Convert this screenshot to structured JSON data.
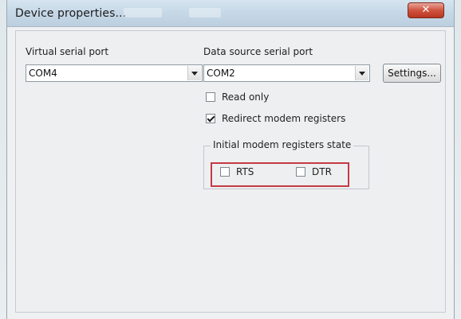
{
  "window": {
    "title": "Device properties...",
    "close_label": "✕"
  },
  "left_panel": {
    "virtual_serial_port_label": "Virtual serial port",
    "virtual_serial_port_value": "COM4"
  },
  "right_panel": {
    "data_source_label": "Data source serial port",
    "data_source_value": "COM2",
    "settings_button": "Settings...",
    "read_only_label": "Read only",
    "read_only_checked": false,
    "redirect_label": "Redirect modem registers",
    "redirect_checked": true,
    "group_title": "Initial modem registers state",
    "rts_label": "RTS",
    "rts_checked": false,
    "dtr_label": "DTR",
    "dtr_checked": false
  },
  "colors": {
    "highlight": "#c43a45",
    "close_button": "#d0533f"
  },
  "icons": {
    "close": "close-icon",
    "dropdown": "chevron-down-icon",
    "checkmark": "check-icon"
  }
}
